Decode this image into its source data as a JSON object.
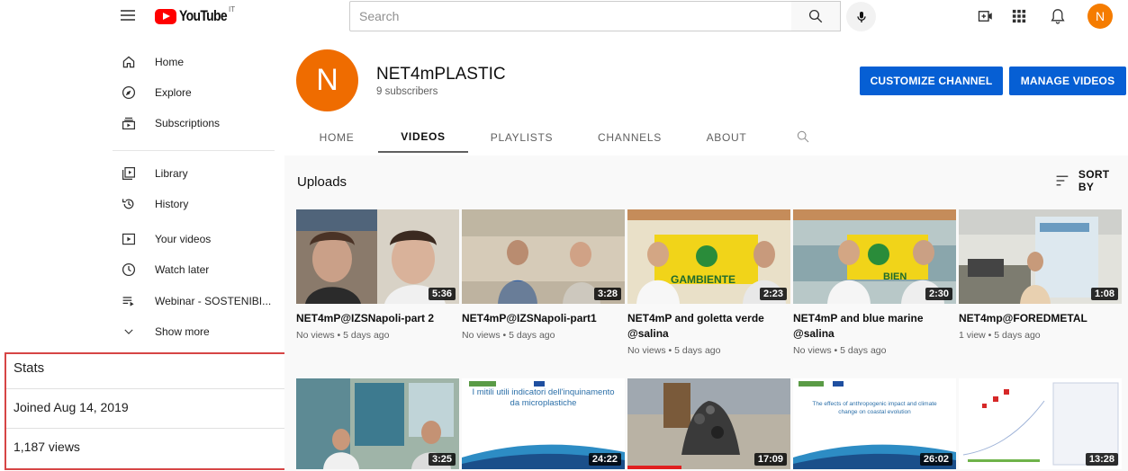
{
  "topbar": {
    "logo_text": "YouTube",
    "logo_country": "IT",
    "search_placeholder": "Search",
    "avatar_letter": "N",
    "menu_icon": "hamburger-icon",
    "icons": [
      "search-icon",
      "mic-icon",
      "create-video-icon",
      "apps-grid-icon",
      "notifications-bell-icon"
    ]
  },
  "sidebar": {
    "items": [
      {
        "label": "Home",
        "icon": "home-icon"
      },
      {
        "label": "Explore",
        "icon": "compass-icon"
      },
      {
        "label": "Subscriptions",
        "icon": "subscriptions-icon"
      },
      {
        "label": "Library",
        "icon": "library-icon"
      },
      {
        "label": "History",
        "icon": "history-icon"
      },
      {
        "label": "Your videos",
        "icon": "your-videos-icon"
      },
      {
        "label": "Watch later",
        "icon": "clock-icon"
      },
      {
        "label": "Webinar - SOSTENIBI...",
        "icon": "playlist-icon"
      },
      {
        "label": "Show more",
        "icon": "chevron-down-icon"
      }
    ]
  },
  "stats": {
    "title": "Stats",
    "joined": "Joined Aug 14, 2019",
    "views": "1,187 views"
  },
  "channel": {
    "avatar_letter": "N",
    "name": "NET4mPLASTIC",
    "subscribers": "9 subscribers",
    "customize_label": "CUSTOMIZE CHANNEL",
    "manage_label": "MANAGE VIDEOS",
    "tabs": [
      "HOME",
      "VIDEOS",
      "PLAYLISTS",
      "CHANNELS",
      "ABOUT"
    ],
    "active_tab": "VIDEOS"
  },
  "uploads": {
    "title": "Uploads",
    "sort_label": "SORT BY",
    "row1": [
      {
        "title": "NET4mP@IZSNapoli-part 2",
        "meta": "No views • 5 days ago",
        "duration": "5:36"
      },
      {
        "title": "NET4mP@IZSNapoli-part1",
        "meta": "No views • 5 days ago",
        "duration": "3:28"
      },
      {
        "title": "NET4mP and goletta verde @salina",
        "meta": "No views • 5 days ago",
        "duration": "2:23"
      },
      {
        "title": "NET4mP and blue marine @salina",
        "meta": "No views • 5 days ago",
        "duration": "2:30"
      },
      {
        "title": "NET4mp@FOREDMETAL",
        "meta": "1 view • 5 days ago",
        "duration": "1:08"
      }
    ],
    "row2": [
      {
        "duration": "3:25"
      },
      {
        "duration": "24:22",
        "thumb_title": "I mitili utili indicatori dell'inquinamento da microplastiche"
      },
      {
        "duration": "17:09"
      },
      {
        "duration": "26:02",
        "thumb_title": "The effects of anthropogenic impact and climate change on coastal evolution"
      },
      {
        "duration": "13:28"
      }
    ]
  },
  "colors": {
    "brand_red": "#ff0000",
    "button_blue": "#065fd4",
    "avatar_orange": "#ef6c00",
    "stats_border": "#d64545"
  }
}
